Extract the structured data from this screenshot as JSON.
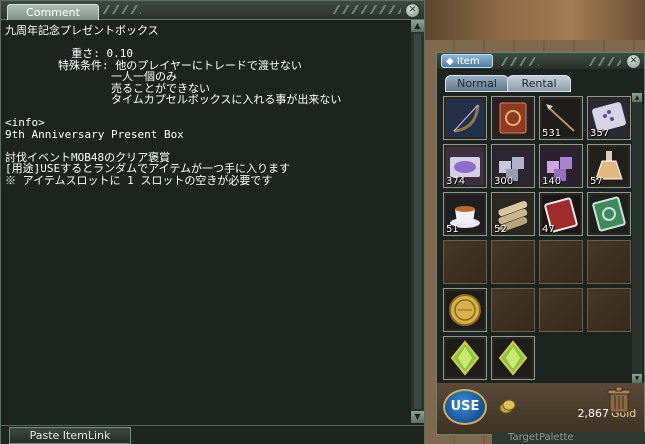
{
  "comment_window": {
    "tab_label": "Comment",
    "lines": [
      "九周年記念プレゼントボックス",
      "",
      "          重さ: 0.10",
      "        特殊条件: 他のプレイヤーにトレードで渡せない",
      "                一人一個のみ",
      "                売ることができない",
      "                タイムカプセルボックスに入れる事が出来ない",
      "",
      "<info>",
      "9th Anniversary Present Box",
      "",
      "討伐イベントMOB48のクリア褒賞",
      "[用途]USEするとランダムでアイテムが一つ手に入ります",
      "※ アイテムスロットに 1 スロットの空きが必要です"
    ],
    "paste_button_label": "Paste ItemLink"
  },
  "item_window": {
    "title": "Item",
    "tabs": [
      {
        "label": "Normal",
        "selected": true
      },
      {
        "label": "Rental",
        "selected": false
      }
    ],
    "slots": [
      {
        "icon": "bow-icon",
        "qty": ""
      },
      {
        "icon": "red-spellbook-icon",
        "qty": ""
      },
      {
        "icon": "arrow-icon",
        "qty": "531"
      },
      {
        "icon": "powder-packet-icon",
        "qty": "357"
      },
      {
        "icon": "purple-powder-icon",
        "qty": "374"
      },
      {
        "icon": "silver-ore-icon",
        "qty": "300"
      },
      {
        "icon": "amethyst-ore-icon",
        "qty": "140"
      },
      {
        "icon": "potion-flask-icon",
        "qty": "57"
      },
      {
        "icon": "tea-cup-icon",
        "qty": "51"
      },
      {
        "icon": "scroll-bundle-icon",
        "qty": "52"
      },
      {
        "icon": "red-book-icon",
        "qty": "47"
      },
      {
        "icon": "green-book-icon",
        "qty": ""
      },
      {
        "icon": "empty",
        "qty": ""
      },
      {
        "icon": "empty",
        "qty": ""
      },
      {
        "icon": "empty",
        "qty": ""
      },
      {
        "icon": "empty",
        "qty": ""
      },
      {
        "icon": "gold-coin-icon",
        "qty": ""
      },
      {
        "icon": "empty",
        "qty": ""
      },
      {
        "icon": "empty",
        "qty": ""
      },
      {
        "icon": "empty",
        "qty": ""
      },
      {
        "icon": "green-crystal-icon",
        "qty": ""
      },
      {
        "icon": "green-crystal-icon",
        "qty": ""
      }
    ],
    "use_button_label": "USE",
    "gold_amount": "2,867",
    "gold_label": "Gold"
  },
  "target_palette_label": "TargetPalette",
  "colors": {
    "window_bg": "#1d2420",
    "window_border": "#5b6e62",
    "text": "#ffffff",
    "use_button": "#17508f",
    "gold": "#e9d48a"
  }
}
